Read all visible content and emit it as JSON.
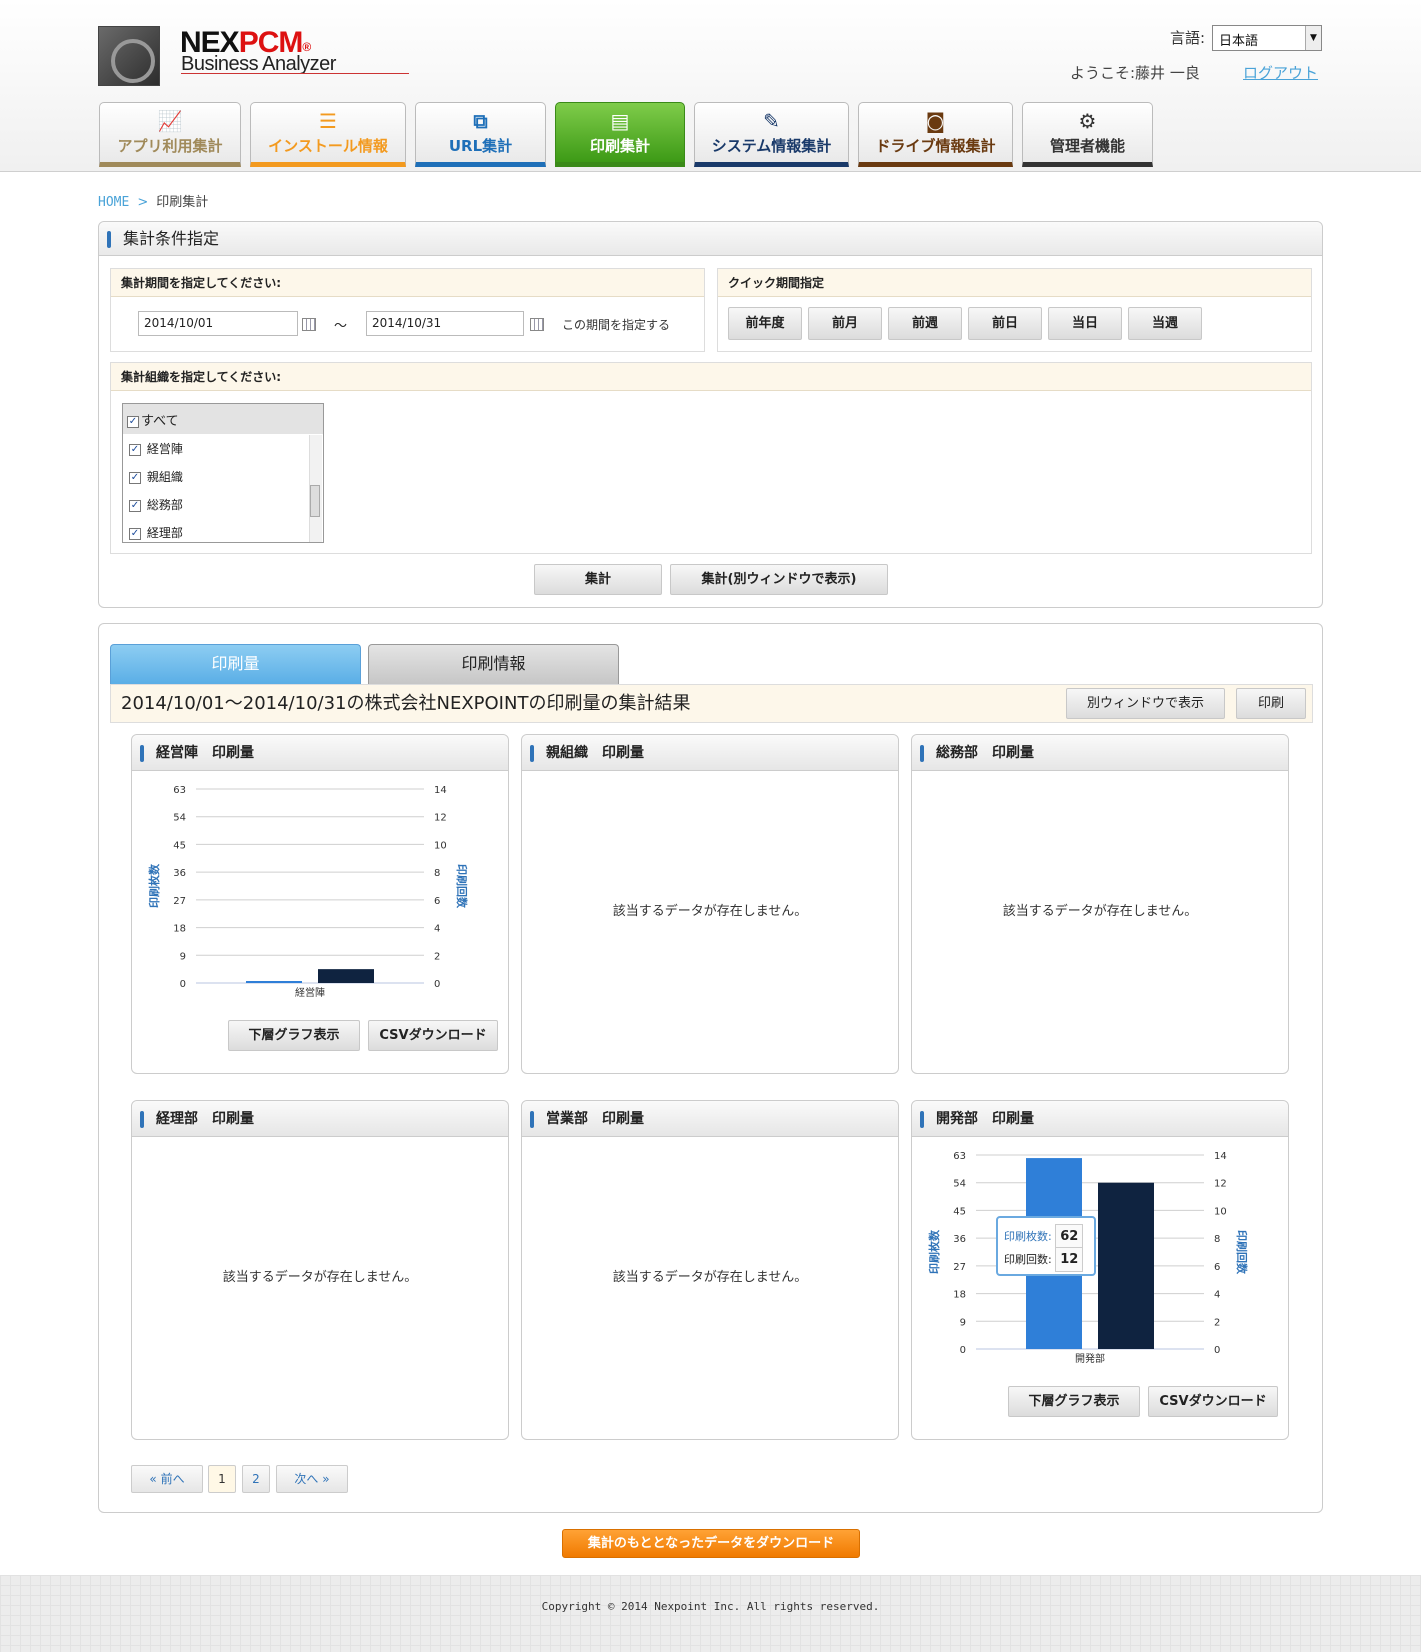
{
  "header": {
    "brand_main": "NEXPCM",
    "brand_sub": "Business Analyzer",
    "lang_label": "言語:",
    "lang_value": "日本語",
    "welcome": "ようこそ:藤井 一良",
    "logout": "ログアウト"
  },
  "nav": [
    {
      "label": "アプリ利用集計",
      "icon": "chart-icon",
      "color": "#a08a5a"
    },
    {
      "label": "インストール情報",
      "icon": "list-icon",
      "color": "#f39a1f"
    },
    {
      "label": "URL集計",
      "icon": "link-icon",
      "color": "#1e6fb8"
    },
    {
      "label": "印刷集計",
      "icon": "document-icon",
      "color": "#3d9a16"
    },
    {
      "label": "システム情報集計",
      "icon": "edit-icon",
      "color": "#1a3a6a"
    },
    {
      "label": "ドライブ情報集計",
      "icon": "rss-icon",
      "color": "#6a3a10"
    },
    {
      "label": "管理者機能",
      "icon": "gear-icon",
      "color": "#333333"
    }
  ],
  "breadcrumb": {
    "home": "HOME",
    "current": "印刷集計"
  },
  "conditions": {
    "title": "集計条件指定",
    "period_label": "集計期間を指定してください:",
    "date_from": "2014/10/01",
    "tilde": "〜",
    "date_to": "2014/10/31",
    "apply_period": "この期間を指定する",
    "quick_label": "クイック期間指定",
    "quick_buttons": [
      "前年度",
      "前月",
      "前週",
      "前日",
      "当日",
      "当週"
    ],
    "org_label": "集計組織を指定してください:",
    "org_all": "すべて",
    "org_items": [
      "経営陣",
      "親組織",
      "総務部",
      "経理部"
    ],
    "aggregate": "集計",
    "aggregate_window": "集計(別ウィンドウで表示)"
  },
  "results": {
    "tabs": [
      "印刷量",
      "印刷情報"
    ],
    "title": "2014/10/01〜2014/10/31の株式会社NEXPOINTの印刷量の集計結果",
    "open_window": "別ウィンドウで表示",
    "print": "印刷",
    "panels": [
      {
        "title": "経営陣　印刷量"
      },
      {
        "title": "親組織　印刷量"
      },
      {
        "title": "総務部　印刷量"
      },
      {
        "title": "経理部　印刷量"
      },
      {
        "title": "営業部　印刷量"
      },
      {
        "title": "開発部　印刷量"
      }
    ],
    "no_data": "該当するデータが存在しません。",
    "drill_down": "下層グラフ表示",
    "csv": "CSVダウンロード",
    "pager": {
      "prev": "« 前へ",
      "pages": [
        "1",
        "2"
      ],
      "next": "次へ »"
    }
  },
  "download_source": "集計のもととなったデータをダウンロード",
  "footer": "Copyright © 2014 Nexpoint Inc. All rights reserved.",
  "chart_data": [
    {
      "type": "bar",
      "title": "経営陣　印刷量",
      "categories": [
        "経営陣"
      ],
      "series": [
        {
          "name": "印刷枚数",
          "values": [
            0
          ],
          "color": "#2f7fd8"
        },
        {
          "name": "印刷回数",
          "values": [
            1
          ],
          "color": "#0f2340"
        }
      ],
      "ylabel": "印刷枚数",
      "y2label": "印刷回数",
      "ylim": [
        0,
        63
      ],
      "y2lim": [
        0,
        14
      ],
      "yticks": [
        0,
        9,
        18,
        27,
        36,
        45,
        54,
        63
      ],
      "y2ticks": [
        0,
        2,
        4,
        6,
        8,
        10,
        12,
        14
      ],
      "grid": true
    },
    {
      "type": "bar",
      "title": "開発部　印刷量",
      "categories": [
        "開発部"
      ],
      "series": [
        {
          "name": "印刷枚数",
          "values": [
            62
          ],
          "color": "#2f7fd8"
        },
        {
          "name": "印刷回数",
          "values": [
            12
          ],
          "color": "#0f2340"
        }
      ],
      "ylabel": "印刷枚数",
      "y2label": "印刷回数",
      "ylim": [
        0,
        63
      ],
      "y2lim": [
        0,
        14
      ],
      "yticks": [
        0,
        9,
        18,
        27,
        36,
        45,
        54,
        63
      ],
      "y2ticks": [
        0,
        2,
        4,
        6,
        8,
        10,
        12,
        14
      ],
      "grid": true,
      "tooltip": {
        "label1": "印刷枚数:",
        "value1": "62",
        "label2": "印刷回数:",
        "value2": "12"
      }
    }
  ]
}
